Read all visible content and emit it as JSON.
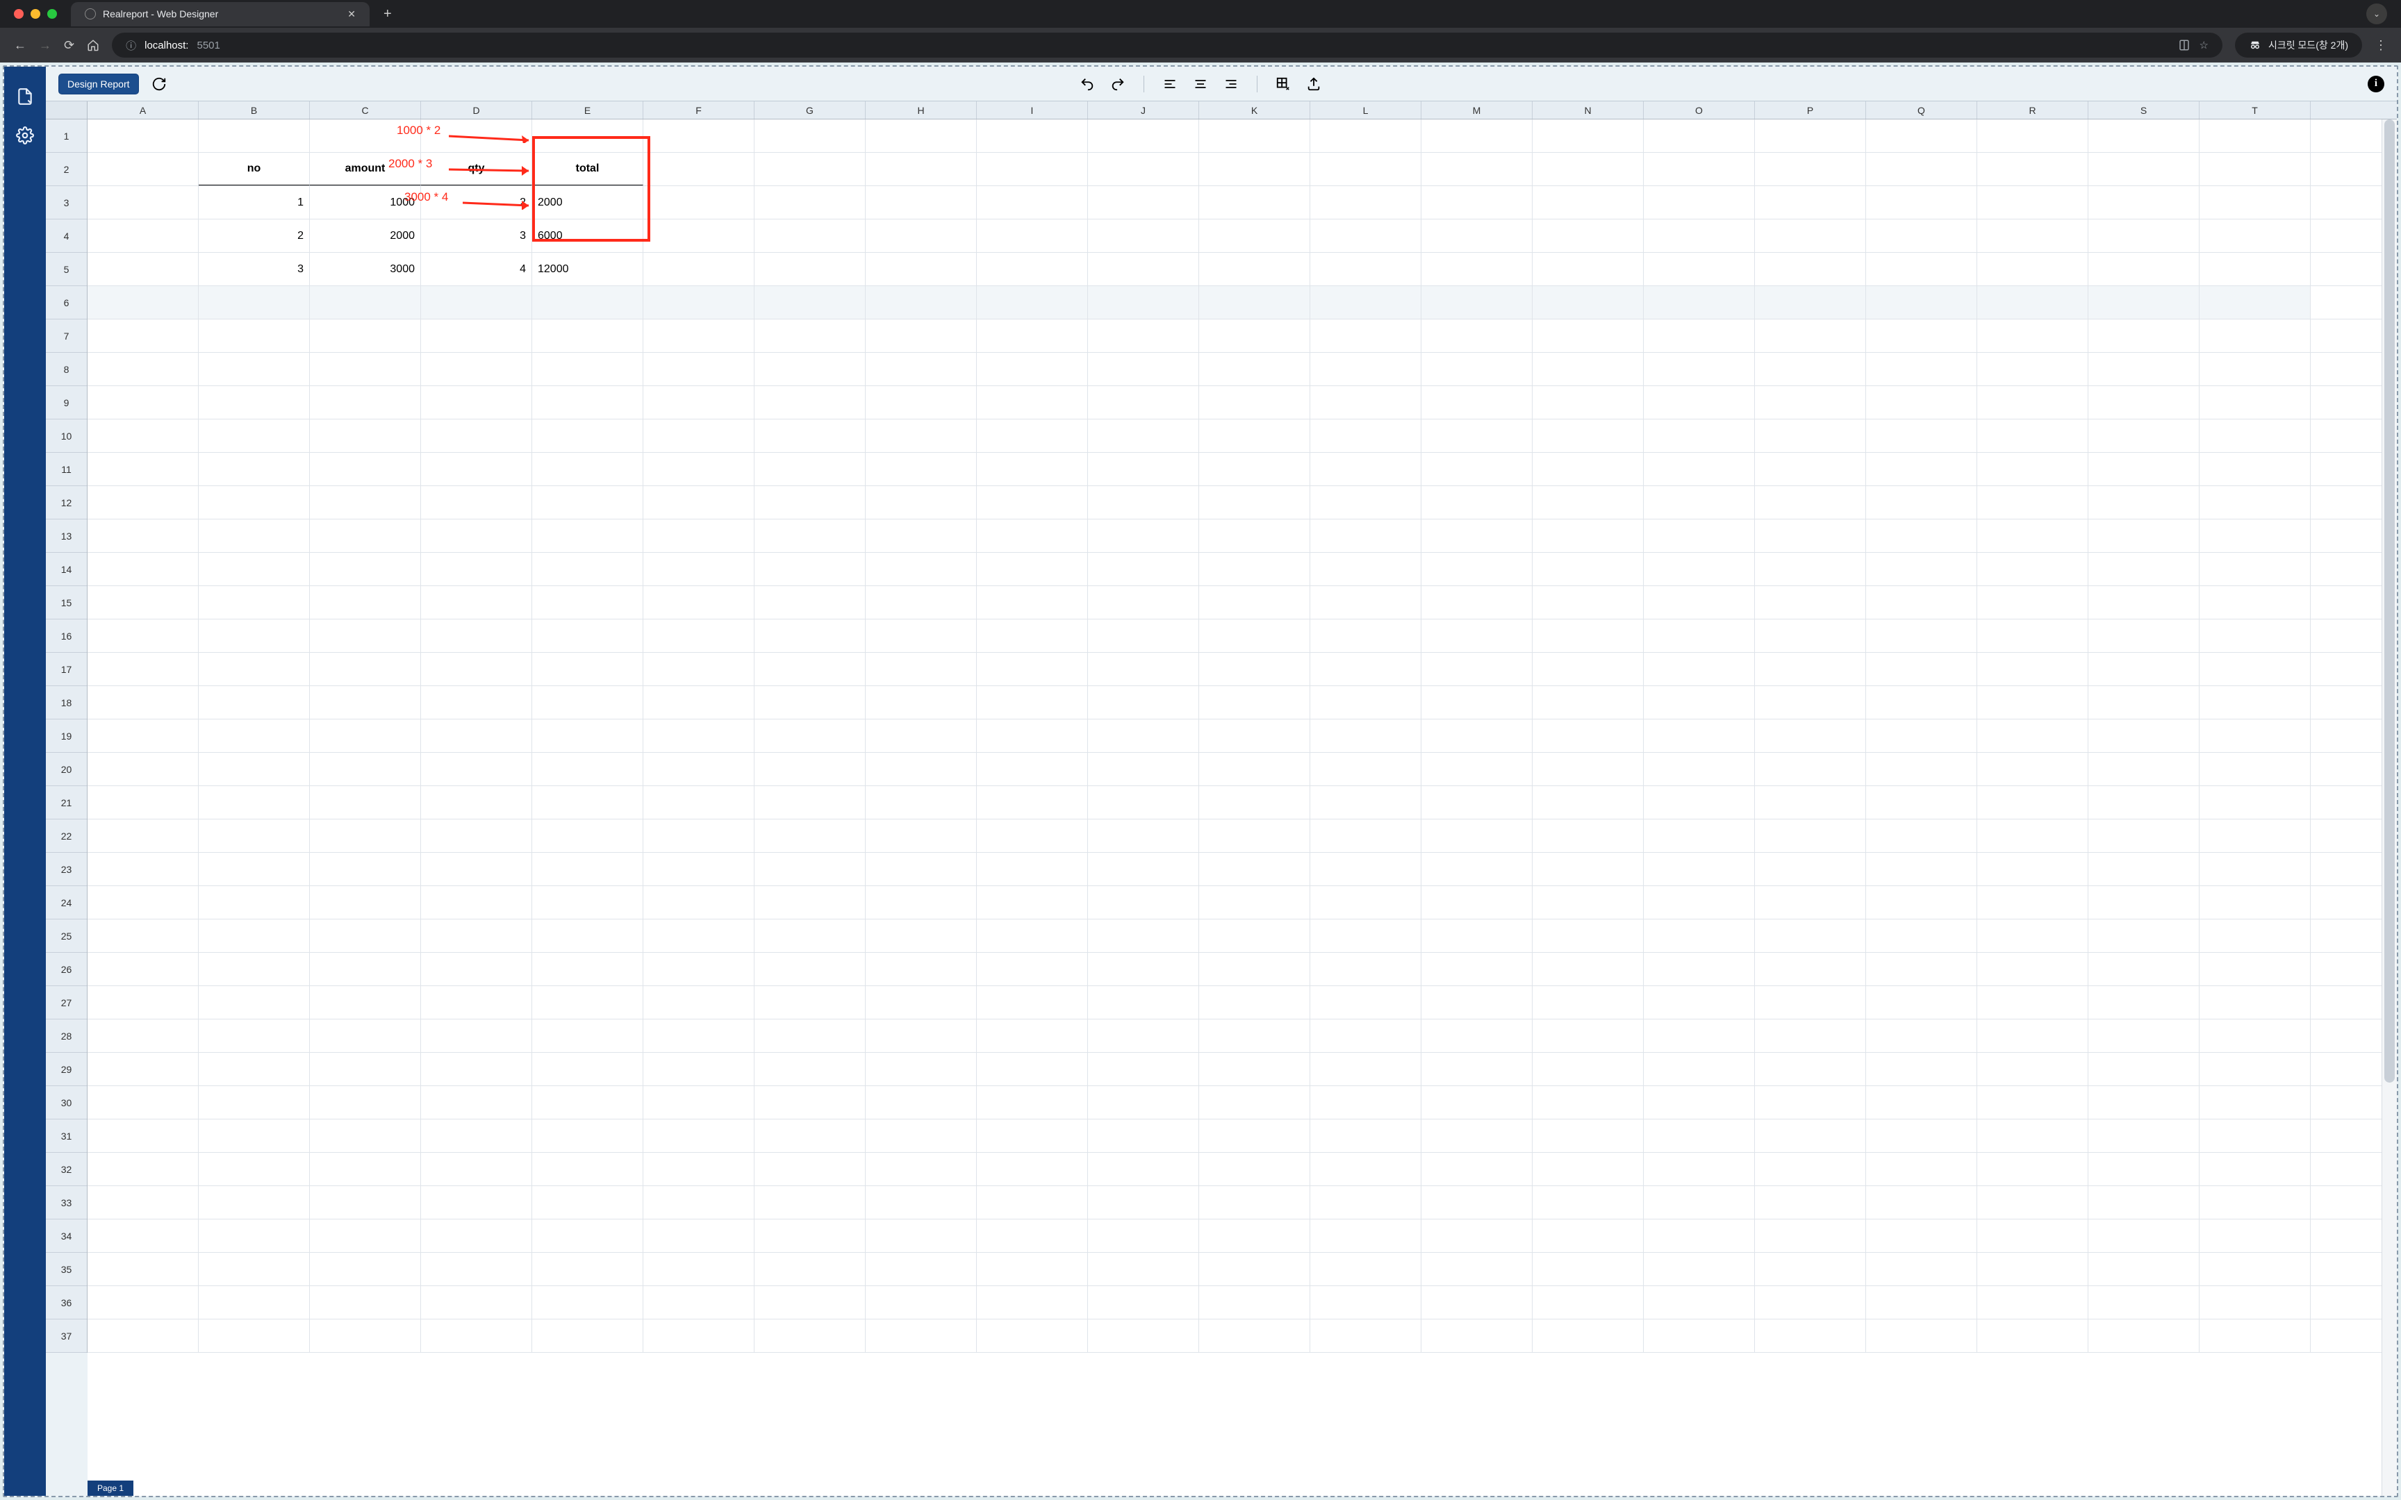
{
  "browser": {
    "tab_title": "Realreport - Web Designer",
    "url_host": "localhost:",
    "url_port": "5501",
    "incognito_label": "시크릿 모드(창 2개)"
  },
  "toolbar": {
    "design_report_label": "Design Report"
  },
  "columns": [
    "A",
    "B",
    "C",
    "D",
    "E",
    "F",
    "G",
    "H",
    "I",
    "J",
    "K",
    "L",
    "M",
    "N",
    "O",
    "P",
    "Q",
    "R",
    "S",
    "T"
  ],
  "rows": [
    "1",
    "2",
    "3",
    "4",
    "5",
    "6",
    "7",
    "8",
    "9",
    "10",
    "11",
    "12",
    "13",
    "14",
    "15",
    "16",
    "17",
    "18",
    "19",
    "20",
    "21",
    "22",
    "23",
    "24",
    "25",
    "26",
    "27",
    "28",
    "29",
    "30",
    "31",
    "32",
    "33",
    "34",
    "35",
    "36",
    "37"
  ],
  "table": {
    "headers": {
      "no": "no",
      "amount": "amount",
      "qty": "qty",
      "total": "total"
    },
    "r1": {
      "no": "1",
      "amount": "1000",
      "qty": "2",
      "total": "2000"
    },
    "r2": {
      "no": "2",
      "amount": "2000",
      "qty": "3",
      "total": "6000"
    },
    "r3": {
      "no": "3",
      "amount": "3000",
      "qty": "4",
      "total": "12000"
    }
  },
  "annotations": {
    "a1": "1000 * 2",
    "a2": "2000 * 3",
    "a3": "3000 * 4"
  },
  "footer": {
    "page_label": "Page 1"
  }
}
